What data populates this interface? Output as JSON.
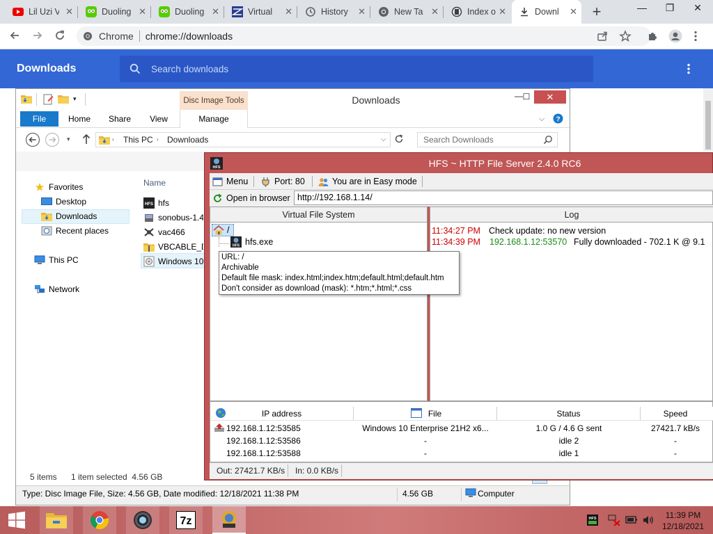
{
  "browser": {
    "tabs": [
      {
        "title": "Lil Uzi V",
        "icon": "youtube-icon"
      },
      {
        "title": "Duoling",
        "icon": "duolingo-icon"
      },
      {
        "title": "Duoling",
        "icon": "duolingo-icon"
      },
      {
        "title": "Virtual",
        "icon": "virtual-cable-icon"
      },
      {
        "title": "History",
        "icon": "history-icon"
      },
      {
        "title": "New Ta",
        "icon": "chrome-icon"
      },
      {
        "title": "Index o",
        "icon": "server-icon"
      },
      {
        "title": "Downl",
        "icon": "download-icon"
      }
    ],
    "omnibox": {
      "site": "Chrome",
      "url": "chrome://downloads"
    }
  },
  "downloads_page": {
    "title": "Downloads",
    "search_placeholder": "Search downloads"
  },
  "explorer": {
    "qat_title": "Downloads",
    "contextual_tab": "Disc Image Tools",
    "ribbon_tabs": [
      "File",
      "Home",
      "Share",
      "View",
      "Manage"
    ],
    "breadcrumb": [
      "This PC",
      "Downloads"
    ],
    "search_placeholder": "Search Downloads",
    "nav": {
      "favorites": "Favorites",
      "desktop": "Desktop",
      "downloads": "Downloads",
      "recent": "Recent places",
      "this_pc": "This PC",
      "network": "Network"
    },
    "column_name": "Name",
    "files": [
      {
        "name": "hfs",
        "icon": "hfs-icon"
      },
      {
        "name": "sonobus-1.4",
        "icon": "installer-icon"
      },
      {
        "name": "vac466",
        "icon": "audio-cable-icon"
      },
      {
        "name": "VBCABLE_Dr",
        "icon": "zip-folder-icon"
      },
      {
        "name": "Windows 10",
        "icon": "disc-image-icon"
      }
    ],
    "status_items": "5 items",
    "status_selected": "1 item selected  4.56 GB",
    "details": "Type: Disc Image File, Size: 4.56 GB, Date modified: 12/18/2021 11:38 PM",
    "details_size": "4.56 GB",
    "details_location": "Computer"
  },
  "hfs": {
    "title": "HFS ~ HTTP File Server 2.4.0 RC6",
    "menu": "Menu",
    "port": "Port: 80",
    "mode": "You are in Easy mode",
    "open_in_browser": "Open in browser",
    "url": "http://192.168.1.14/",
    "vfs_header": "Virtual File System",
    "log_header": "Log",
    "vfs_root": "/",
    "vfs_file": "hfs.exe",
    "tooltip": [
      "URL: /",
      "Archivable",
      "Default file mask: index.html;index.htm;default.html;default.htm",
      "Don't consider as download (mask): *.htm;*.html;*.css"
    ],
    "log": [
      {
        "time": "11:34:27 PM",
        "address": "",
        "message": "Check update: no new version"
      },
      {
        "time": "11:34:39 PM",
        "address": "192.168.1.12:53570",
        "message": "Fully downloaded - 702.1 K @ 9.1"
      }
    ],
    "connections_headers": [
      "IP address",
      "File",
      "Status",
      "Speed"
    ],
    "connections": [
      {
        "ip": "192.168.1.12:53585",
        "file": "Windows 10 Enterprise 21H2 x6...",
        "status": "1.0 G / 4.6 G sent",
        "speed": "27421.7 kB/s"
      },
      {
        "ip": "192.168.1.12:53586",
        "file": "-",
        "status": "idle 2",
        "speed": "-"
      },
      {
        "ip": "192.168.1.12:53588",
        "file": "-",
        "status": "idle 1",
        "speed": "-"
      }
    ],
    "out": "Out: 27421.7 KB/s",
    "in": "In: 0.0 KB/s"
  },
  "taskbar": {
    "time": "11:39 PM",
    "date": "12/18/2021",
    "apps": [
      "file-explorer-icon",
      "chrome-icon",
      "obs-icon",
      "7zip-icon",
      "hfs-icon"
    ]
  },
  "colors": {
    "chrome_blue": "#3367d6",
    "hfs_frame": "#c05656",
    "log_time": "#cc0000",
    "log_ip": "#1a8a1a",
    "ribbon_file": "#1979ca"
  }
}
